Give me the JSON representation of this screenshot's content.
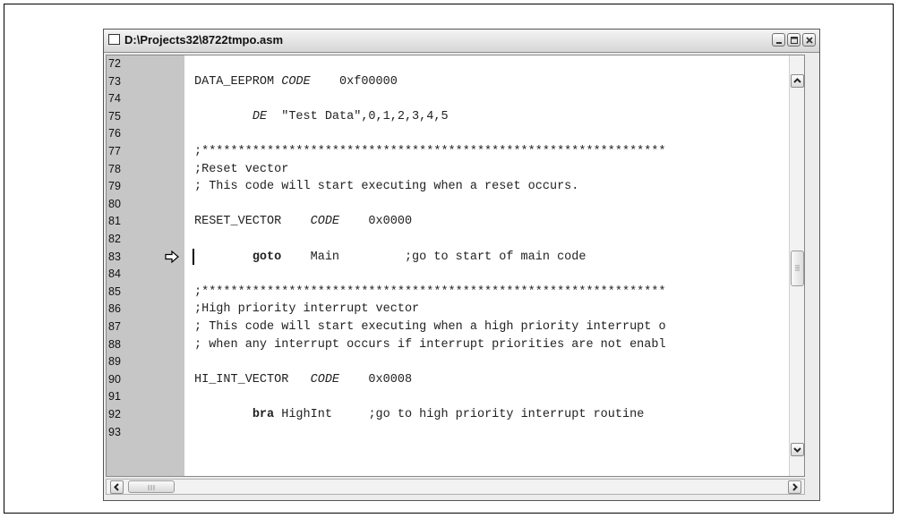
{
  "window": {
    "title": "D:\\Projects32\\8722tmpo.asm",
    "buttons": [
      "minimize",
      "maximize",
      "close"
    ]
  },
  "editor": {
    "current_line": "83",
    "lines": [
      {
        "num": "72",
        "parts": []
      },
      {
        "num": "73",
        "parts": [
          {
            "t": "DATA_EEPROM ",
            "s": ""
          },
          {
            "t": "CODE",
            "s": "it"
          },
          {
            "t": "    0xf00000",
            "s": ""
          }
        ]
      },
      {
        "num": "74",
        "parts": []
      },
      {
        "num": "75",
        "parts": [
          {
            "t": "        ",
            "s": ""
          },
          {
            "t": "DE",
            "s": "it"
          },
          {
            "t": "  \"Test Data\",0,1,2,3,4,5",
            "s": ""
          }
        ]
      },
      {
        "num": "76",
        "parts": []
      },
      {
        "num": "77",
        "parts": [
          {
            "t": ";****************************************************************",
            "s": ""
          }
        ]
      },
      {
        "num": "78",
        "parts": [
          {
            "t": ";Reset vector",
            "s": ""
          }
        ]
      },
      {
        "num": "79",
        "parts": [
          {
            "t": "; This code will start executing when a reset occurs.",
            "s": ""
          }
        ]
      },
      {
        "num": "80",
        "parts": []
      },
      {
        "num": "81",
        "parts": [
          {
            "t": "RESET_VECTOR    ",
            "s": ""
          },
          {
            "t": "CODE",
            "s": "it"
          },
          {
            "t": "    0x0000",
            "s": ""
          }
        ]
      },
      {
        "num": "82",
        "parts": []
      },
      {
        "num": "83",
        "parts": [
          {
            "t": "        ",
            "s": ""
          },
          {
            "t": "goto",
            "s": "kw"
          },
          {
            "t": "    Main         ;go to start of main code",
            "s": ""
          }
        ]
      },
      {
        "num": "84",
        "parts": []
      },
      {
        "num": "85",
        "parts": [
          {
            "t": ";****************************************************************",
            "s": ""
          }
        ]
      },
      {
        "num": "86",
        "parts": [
          {
            "t": ";High priority interrupt vector",
            "s": ""
          }
        ]
      },
      {
        "num": "87",
        "parts": [
          {
            "t": "; This code will start executing when a high priority interrupt o",
            "s": ""
          }
        ]
      },
      {
        "num": "88",
        "parts": [
          {
            "t": "; when any interrupt occurs if interrupt priorities are not enabl",
            "s": ""
          }
        ]
      },
      {
        "num": "89",
        "parts": []
      },
      {
        "num": "90",
        "parts": [
          {
            "t": "HI_INT_VECTOR   ",
            "s": ""
          },
          {
            "t": "CODE",
            "s": "it"
          },
          {
            "t": "    0x0008",
            "s": ""
          }
        ]
      },
      {
        "num": "91",
        "parts": []
      },
      {
        "num": "92",
        "parts": [
          {
            "t": "        ",
            "s": ""
          },
          {
            "t": "bra",
            "s": "kw"
          },
          {
            "t": " HighInt     ;go to high priority interrupt routine",
            "s": ""
          }
        ]
      },
      {
        "num": "93",
        "parts": []
      }
    ]
  },
  "icons": {
    "current_line_marker": "arrow-right-icon",
    "scroll_up": "chevron-up-icon",
    "scroll_down": "chevron-down-icon",
    "scroll_left": "chevron-left-icon",
    "scroll_right": "chevron-right-icon"
  },
  "colors": {
    "gutter": "#c6c6c6",
    "editor_bg": "#ffffff",
    "titlebar": "#e0e0e0"
  }
}
